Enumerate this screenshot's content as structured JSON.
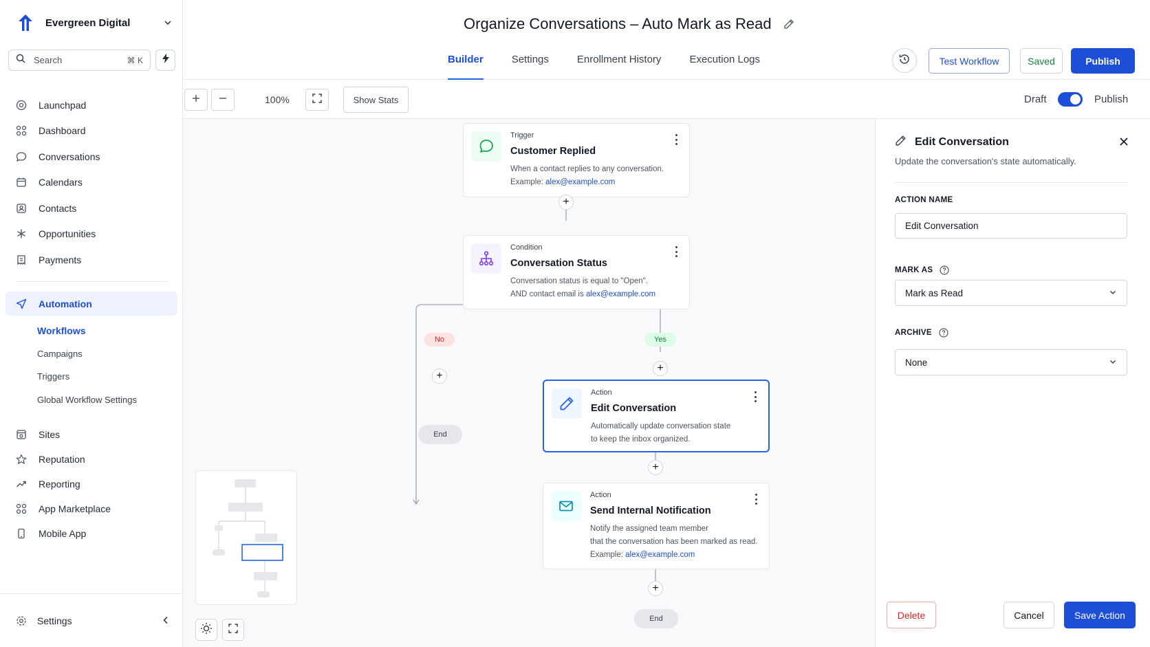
{
  "workspace": {
    "name": "Evergreen Digital"
  },
  "search": {
    "placeholder": "Search",
    "shortcut": "⌘ K"
  },
  "sidebar": {
    "items": [
      {
        "label": "Launchpad",
        "icon": "launchpad-icon"
      },
      {
        "label": "Dashboard",
        "icon": "dashboard-icon"
      },
      {
        "label": "Conversations",
        "icon": "chat-icon"
      },
      {
        "label": "Calendars",
        "icon": "calendar-icon"
      },
      {
        "label": "Contacts",
        "icon": "contacts-icon"
      },
      {
        "label": "Opportunities",
        "icon": "opportunities-icon"
      },
      {
        "label": "Payments",
        "icon": "payments-icon"
      }
    ],
    "automation": {
      "label": "Automation",
      "icon": "send-icon"
    },
    "automation_sub": [
      {
        "label": "Workflows",
        "active": true
      },
      {
        "label": "Campaigns"
      },
      {
        "label": "Triggers"
      },
      {
        "label": "Global Workflow Settings"
      }
    ],
    "items2": [
      {
        "label": "Sites",
        "icon": "sites-icon"
      },
      {
        "label": "Reputation",
        "icon": "star-icon"
      },
      {
        "label": "Reporting",
        "icon": "trend-icon"
      },
      {
        "label": "App Marketplace",
        "icon": "apps-icon"
      },
      {
        "label": "Mobile App",
        "icon": "mobile-icon"
      }
    ],
    "settings": "Settings"
  },
  "header": {
    "title": "Organize Conversations – Auto Mark as Read",
    "tabs": [
      "Builder",
      "Settings",
      "Enrollment History",
      "Execution Logs"
    ],
    "active_tab": "Builder",
    "test_label": "Test Workflow",
    "saved_label": "Saved",
    "publish_label": "Publish"
  },
  "toolbar": {
    "zoom": "100%",
    "show_stats": "Show Stats",
    "draft_label": "Draft",
    "publish_label": "Publish",
    "published": true
  },
  "workflow": {
    "trigger": {
      "kind": "Trigger",
      "title": "Customer Replied",
      "desc1": "When a contact replies to any conversation.",
      "desc2_prefix": "Example: ",
      "desc2_link": "alex@example.com"
    },
    "condition": {
      "kind": "Condition",
      "title": "Conversation Status",
      "desc1": "Conversation status is equal to \"Open\".",
      "desc2_prefix": "AND contact email is ",
      "desc2_link": "alex@example.com"
    },
    "branch_no": "No",
    "branch_yes": "Yes",
    "end_label": "End",
    "action1": {
      "kind": "Action",
      "title": "Edit Conversation",
      "desc1": "Automatically update conversation state",
      "desc2": "to keep the inbox organized."
    },
    "action2": {
      "kind": "Action",
      "title": "Send Internal Notification",
      "desc1": "Notify the assigned team member",
      "desc2": "that the conversation has been marked as read.",
      "desc3_prefix": "Example: ",
      "desc3_link": "alex@example.com"
    }
  },
  "panel": {
    "title": "Edit Conversation",
    "subtitle": "Update the conversation's state automatically.",
    "action_name_label": "ACTION NAME",
    "action_name_value": "Edit Conversation",
    "mark_as_label": "MARK AS",
    "mark_as_value": "Mark as Read",
    "archive_label": "ARCHIVE",
    "archive_value": "None",
    "delete_label": "Delete",
    "cancel_label": "Cancel",
    "save_label": "Save Action"
  },
  "colors": {
    "primary": "#1d4ed8",
    "success": "#15803d",
    "danger": "#dc2626"
  }
}
